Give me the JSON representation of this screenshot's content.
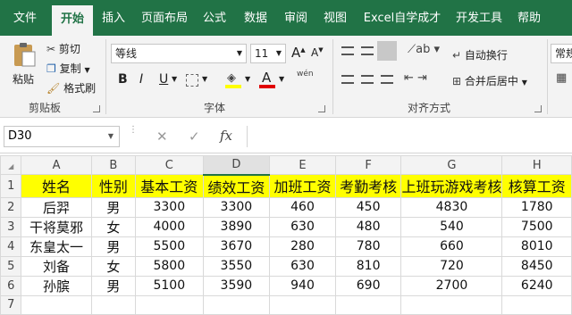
{
  "tabs": [
    "文件",
    "开始",
    "插入",
    "页面布局",
    "公式",
    "数据",
    "审阅",
    "视图",
    "Excel自学成才",
    "开发工具",
    "帮助"
  ],
  "ribbon": {
    "clipboard": {
      "paste": "粘贴",
      "cut": "剪切",
      "copy": "复制",
      "format_painter": "格式刷",
      "group": "剪贴板"
    },
    "font": {
      "name": "等线",
      "size": "11",
      "grow": "A",
      "shrink": "A",
      "bold": "B",
      "italic": "I",
      "underline": "U",
      "color_a": "A",
      "phonetic": "wén",
      "group": "字体"
    },
    "alignment": {
      "wrap": "自动换行",
      "merge": "合并后居中",
      "group": "对齐方式"
    },
    "number": {
      "format": "常规"
    }
  },
  "formula_bar": {
    "name_box": "D30",
    "cancel": "✕",
    "enter": "✓",
    "fx": "fx",
    "formula": ""
  },
  "columns": [
    "A",
    "B",
    "C",
    "D",
    "E",
    "F",
    "G",
    "H"
  ],
  "rows": [
    [
      "1",
      "姓名",
      "性别",
      "基本工资",
      "绩效工资",
      "加班工资",
      "考勤考核",
      "上班玩游戏考核",
      "核算工资"
    ],
    [
      "2",
      "后羿",
      "男",
      "3300",
      "3300",
      "460",
      "450",
      "4830",
      "1780"
    ],
    [
      "3",
      "干将莫邪",
      "女",
      "4000",
      "3890",
      "630",
      "480",
      "540",
      "7500"
    ],
    [
      "4",
      "东皇太一",
      "男",
      "5500",
      "3670",
      "280",
      "780",
      "660",
      "8010"
    ],
    [
      "5",
      "刘备",
      "女",
      "5800",
      "3550",
      "630",
      "810",
      "720",
      "8450"
    ],
    [
      "6",
      "孙膑",
      "男",
      "5100",
      "3590",
      "940",
      "690",
      "2700",
      "6240"
    ],
    [
      "7",
      "",
      "",
      "",
      "",
      "",
      "",
      "",
      ""
    ]
  ],
  "colors": {
    "accent": "#217346",
    "header_fill": "#ffff00"
  }
}
